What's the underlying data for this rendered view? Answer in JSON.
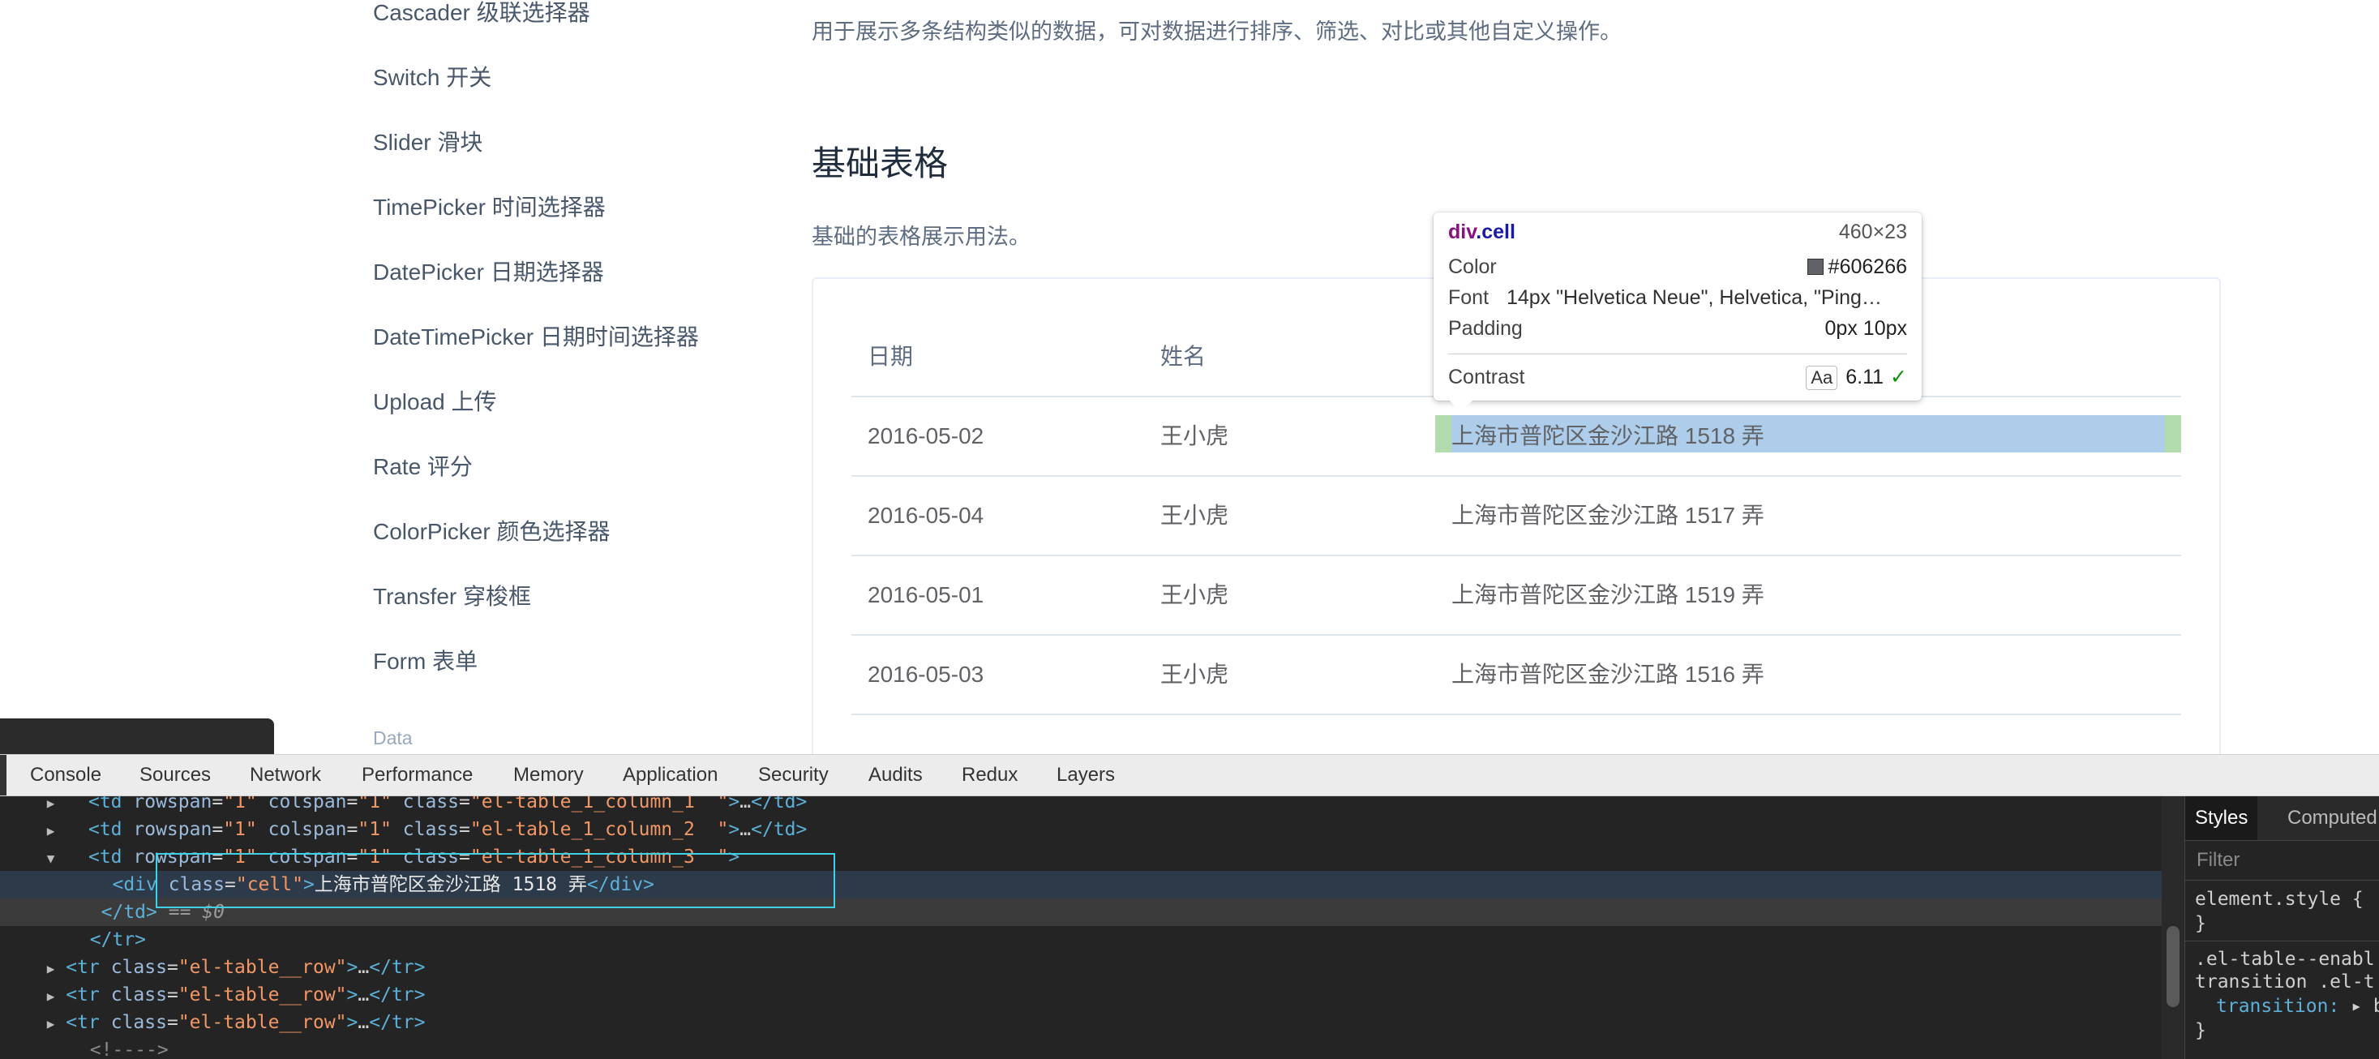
{
  "nav": {
    "items": [
      "Cascader 级联选择器",
      "Switch 开关",
      "Slider 滑块",
      "TimePicker 时间选择器",
      "DatePicker 日期选择器",
      "DateTimePicker 日期时间选择器",
      "Upload 上传",
      "Rate 评分",
      "ColorPicker 颜色选择器",
      "Transfer 穿梭框",
      "Form 表单"
    ],
    "group_label": "Data"
  },
  "content": {
    "intro": "用于展示多条结构类似的数据，可对数据进行排序、筛选、对比或其他自定义操作。",
    "section_title": "基础表格",
    "section_desc": "基础的表格展示用法。",
    "table": {
      "headers": [
        "日期",
        "姓名"
      ],
      "rows": [
        {
          "date": "2016-05-02",
          "name": "王小虎",
          "address": "上海市普陀区金沙江路 1518 弄"
        },
        {
          "date": "2016-05-04",
          "name": "王小虎",
          "address": "上海市普陀区金沙江路 1517 弄"
        },
        {
          "date": "2016-05-01",
          "name": "王小虎",
          "address": "上海市普陀区金沙江路 1519 弄"
        },
        {
          "date": "2016-05-03",
          "name": "王小虎",
          "address": "上海市普陀区金沙江路 1516 弄"
        }
      ]
    }
  },
  "tooltip": {
    "tag": "div",
    "class": ".cell",
    "dims": "460×23",
    "color_label": "Color",
    "color_value": "#606266",
    "font_label": "Font",
    "font_value": "14px \"Helvetica Neue\", Helvetica, \"Ping…",
    "padding_label": "Padding",
    "padding_value": "0px 10px",
    "contrast_label": "Contrast",
    "contrast_aa": "Aa",
    "contrast_value": "6.11",
    "check": "✓"
  },
  "devtools": {
    "tabs": [
      "Console",
      "Sources",
      "Network",
      "Performance",
      "Memory",
      "Application",
      "Security",
      "Audits",
      "Redux",
      "Layers"
    ],
    "styles_tabs": [
      "Styles",
      "Computed"
    ],
    "filter_placeholder": "Filter",
    "element_style": "element.style {",
    "rule_selector_1": ".el-table--enabl",
    "rule_selector_2": "transition .el-t",
    "rule_prop": "transition:",
    "rule_val": "▸ b",
    "close_brace": "}"
  },
  "colors": {
    "nav_text": "#48576a",
    "cell_text": "#606266",
    "highlight_content": "#9fc5e8",
    "highlight_padding": "#a5d6a0",
    "node_outline": "#3fd2e6"
  }
}
